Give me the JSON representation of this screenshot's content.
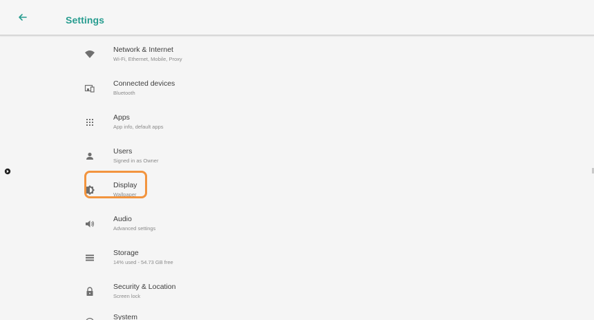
{
  "header": {
    "title": "Settings",
    "back_icon": "arrow-left-icon",
    "accent_color": "#279c8f"
  },
  "settings": {
    "items": [
      {
        "title": "Network & Internet",
        "subtitle": "Wi-Fi, Ethernet, Mobile, Proxy",
        "icon": "wifi-icon"
      },
      {
        "title": "Connected devices",
        "subtitle": "Bluetooth",
        "icon": "devices-icon"
      },
      {
        "title": "Apps",
        "subtitle": "App info, default apps",
        "icon": "apps-grid-icon"
      },
      {
        "title": "Users",
        "subtitle": "Signed in as Owner",
        "icon": "person-icon"
      },
      {
        "title": "Display",
        "subtitle": "Wallpaper",
        "icon": "brightness-icon"
      },
      {
        "title": "Audio",
        "subtitle": "Advanced settings",
        "icon": "speaker-icon"
      },
      {
        "title": "Storage",
        "subtitle": "14% used - 54.73 GB free",
        "icon": "storage-icon"
      },
      {
        "title": "Security & Location",
        "subtitle": "Screen lock",
        "icon": "lock-icon"
      },
      {
        "title": "System",
        "subtitle": "",
        "icon": "info-icon"
      }
    ]
  },
  "annotation": {
    "highlight_color": "#f2943e"
  }
}
